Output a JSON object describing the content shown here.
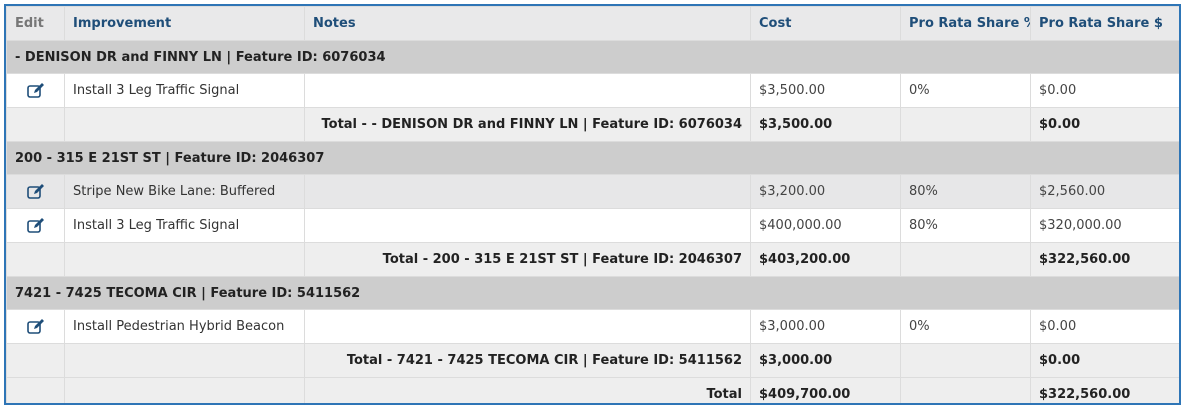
{
  "headers": {
    "edit": "Edit",
    "improvement": "Improvement",
    "notes": "Notes",
    "cost": "Cost",
    "pro_rata_pct": "Pro Rata Share %",
    "pro_rata_amt": "Pro Rata Share $"
  },
  "groups": [
    {
      "title": "- DENISON DR and FINNY LN | Feature ID: 6076034",
      "items": [
        {
          "improvement": "Install 3 Leg Traffic Signal",
          "notes": "",
          "cost": "$3,500.00",
          "pct": "0%",
          "amount": "$0.00"
        }
      ],
      "total": {
        "label": "Total - - DENISON DR and FINNY LN | Feature ID: 6076034",
        "cost": "$3,500.00",
        "amount": "$0.00"
      }
    },
    {
      "title": "200 - 315 E 21ST ST | Feature ID: 2046307",
      "items": [
        {
          "improvement": "Stripe New Bike Lane: Buffered",
          "notes": "",
          "cost": "$3,200.00",
          "pct": "80%",
          "amount": "$2,560.00"
        },
        {
          "improvement": "Install 3 Leg Traffic Signal",
          "notes": "",
          "cost": "$400,000.00",
          "pct": "80%",
          "amount": "$320,000.00"
        }
      ],
      "total": {
        "label": "Total - 200 - 315 E 21ST ST | Feature ID: 2046307",
        "cost": "$403,200.00",
        "amount": "$322,560.00"
      }
    },
    {
      "title": "7421 - 7425 TECOMA CIR | Feature ID: 5411562",
      "items": [
        {
          "improvement": "Install Pedestrian Hybrid Beacon",
          "notes": "",
          "cost": "$3,000.00",
          "pct": "0%",
          "amount": "$0.00"
        }
      ],
      "total": {
        "label": "Total - 7421 - 7425 TECOMA CIR | Feature ID: 5411562",
        "cost": "$3,000.00",
        "amount": "$0.00"
      }
    }
  ],
  "grand_total": {
    "label": "Total",
    "cost": "$409,700.00",
    "amount": "$322,560.00"
  },
  "colors": {
    "accent": "#2e75b6",
    "header_text": "#1f4e79",
    "group_bg": "#cdcdcd"
  },
  "icons": {
    "edit": "edit-icon"
  }
}
